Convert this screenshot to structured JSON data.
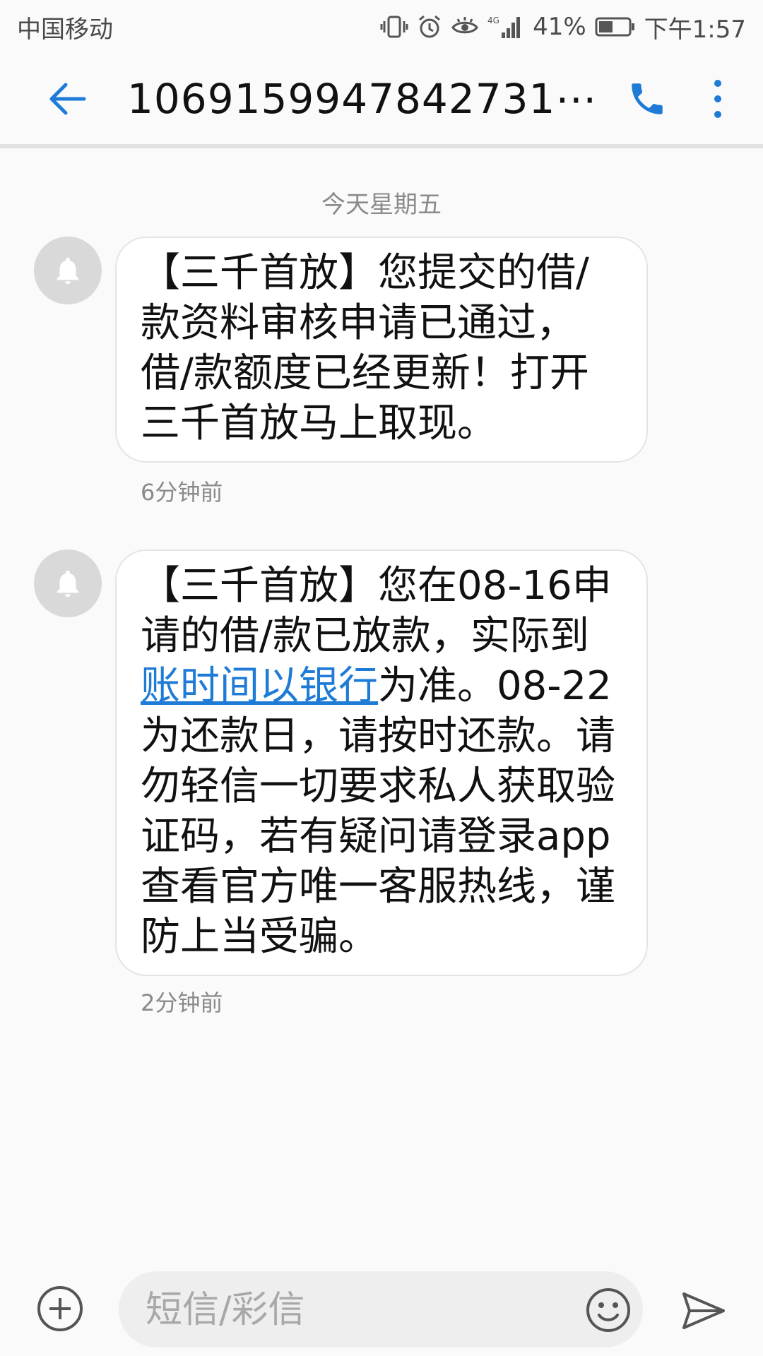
{
  "status_bar": {
    "carrier": "中国移动",
    "network": "4G",
    "battery": "41%",
    "time": "下午1:57"
  },
  "app_bar": {
    "title": "10691599478427​31⋯",
    "icons": [
      "back-arrow-icon",
      "phone-icon",
      "more-vert-icon"
    ]
  },
  "conversation": {
    "date_separator": "今天星期五",
    "messages": [
      {
        "text": "【三千首放】您提交的借/款资料审核申请已通过，借/款额度已经更新！打开三千首放马上取现。",
        "time": "6分钟前"
      },
      {
        "text_before": "【三千首放】您在08-16申请的借/款已放款，实际到",
        "link": "账时间以银行",
        "text_after": "为准。08-22为还款日，请按时还款。请勿轻信一切要求私人获取验证码，若有疑问请登录app查看官方唯一客服热线，谨防上当受骗。",
        "time": "2分钟前"
      }
    ]
  },
  "composer": {
    "placeholder": "短信/彩信",
    "icons": [
      "add-icon",
      "emoji-icon",
      "send-icon"
    ]
  },
  "colors": {
    "accent": "#1e7bd6",
    "background": "#fafafa",
    "bubble": "#ffffff",
    "avatar": "#d9d9d9"
  }
}
